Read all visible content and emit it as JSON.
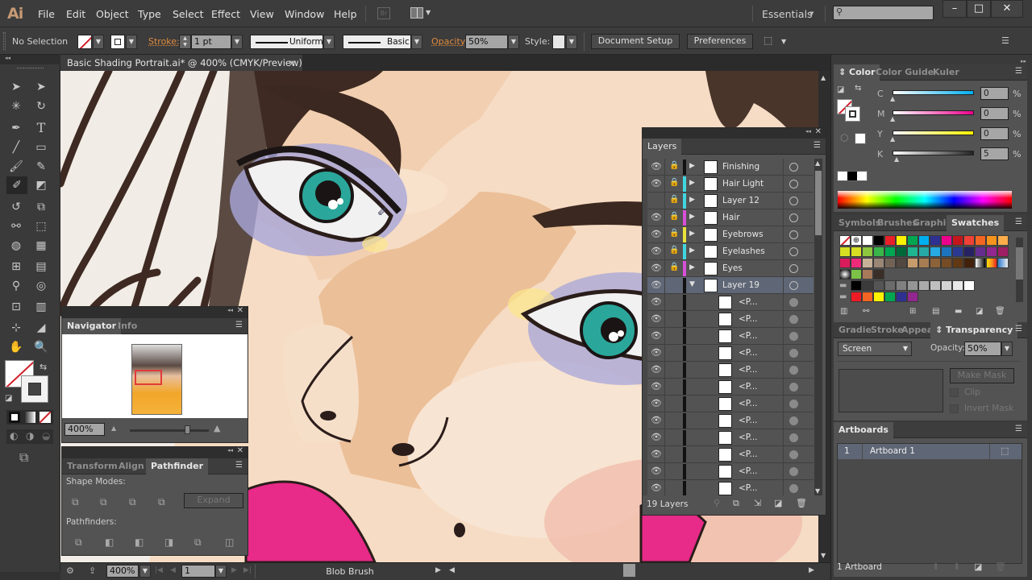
{
  "app": {
    "logo": "Ai",
    "menus": [
      "File",
      "Edit",
      "Object",
      "Type",
      "Select",
      "Effect",
      "View",
      "Window",
      "Help"
    ],
    "bridge_label": "Br",
    "workspace": "Essentials",
    "search_placeholder": "",
    "window_controls": {
      "minimize": "–",
      "maximize": "□",
      "close": "✕"
    }
  },
  "control_bar": {
    "selection_status": "No Selection",
    "stroke_label": "Stroke:",
    "stroke_weight": "1 pt",
    "profile": "Uniform",
    "brush": "Basic",
    "opacity_label": "Opacity:",
    "opacity": "50%",
    "style_label": "Style:",
    "document_setup": "Document Setup",
    "preferences": "Preferences"
  },
  "document": {
    "tab_title": "Basic Shading Portrait.ai* @ 400% (CMYK/Preview)",
    "close": "×"
  },
  "status_bar": {
    "zoom": "400%",
    "artboard_number": "1",
    "current_tool": "Blob Brush"
  },
  "navigator": {
    "tabs": [
      "Navigator",
      "Info"
    ],
    "active_tab": "Navigator",
    "zoom": "400%",
    "zoom_slider_fraction": 0.72
  },
  "pathfinder": {
    "tabs": [
      "Transform",
      "Align",
      "Pathfinder"
    ],
    "active_tab": "Pathfinder",
    "shape_modes_label": "Shape Modes:",
    "pathfinders_label": "Pathfinders:",
    "expand": "Expand",
    "shape_mode_icons": [
      "unite-icon",
      "minus-front-icon",
      "intersect-icon",
      "exclude-icon"
    ],
    "pathfinder_icons": [
      "divide-icon",
      "trim-icon",
      "merge-icon",
      "crop-icon",
      "outline-icon",
      "minus-back-icon"
    ]
  },
  "layers": {
    "title": "Layers",
    "count_label": "19 Layers",
    "rows": [
      {
        "name": "Finishing",
        "visible": true,
        "locked": true,
        "color": "#111111",
        "expanded": false,
        "sub": false
      },
      {
        "name": "Hair Light",
        "visible": true,
        "locked": true,
        "color": "#3fd6e0",
        "expanded": false,
        "sub": false
      },
      {
        "name": "Layer 12",
        "visible": false,
        "locked": true,
        "color": "#3fd6e0",
        "expanded": false,
        "sub": false
      },
      {
        "name": "Hair",
        "visible": true,
        "locked": true,
        "color": "#d84fd8",
        "expanded": false,
        "sub": false
      },
      {
        "name": "Eyebrows",
        "visible": true,
        "locked": true,
        "color": "#e8e23a",
        "expanded": false,
        "sub": false
      },
      {
        "name": "Eyelashes",
        "visible": true,
        "locked": true,
        "color": "#3fd6e0",
        "expanded": false,
        "sub": false
      },
      {
        "name": "Eyes",
        "visible": true,
        "locked": true,
        "color": "#d84fd8",
        "expanded": false,
        "sub": false
      },
      {
        "name": "Layer 19",
        "visible": true,
        "locked": false,
        "color": "#111111",
        "expanded": true,
        "sub": false,
        "selected": true
      },
      {
        "name": "<P...",
        "visible": true,
        "locked": false,
        "color": "#111111",
        "sub": true
      },
      {
        "name": "<P...",
        "visible": true,
        "locked": false,
        "color": "#111111",
        "sub": true
      },
      {
        "name": "<P...",
        "visible": true,
        "locked": false,
        "color": "#111111",
        "sub": true
      },
      {
        "name": "<P...",
        "visible": true,
        "locked": false,
        "color": "#111111",
        "sub": true
      },
      {
        "name": "<P...",
        "visible": true,
        "locked": false,
        "color": "#111111",
        "sub": true
      },
      {
        "name": "<P...",
        "visible": true,
        "locked": false,
        "color": "#111111",
        "sub": true
      },
      {
        "name": "<P...",
        "visible": true,
        "locked": false,
        "color": "#111111",
        "sub": true
      },
      {
        "name": "<P...",
        "visible": true,
        "locked": false,
        "color": "#111111",
        "sub": true
      },
      {
        "name": "<P...",
        "visible": true,
        "locked": false,
        "color": "#111111",
        "sub": true
      },
      {
        "name": "<P...",
        "visible": true,
        "locked": false,
        "color": "#111111",
        "sub": true
      },
      {
        "name": "<P...",
        "visible": true,
        "locked": false,
        "color": "#111111",
        "sub": true
      },
      {
        "name": "<P...",
        "visible": true,
        "locked": false,
        "color": "#111111",
        "sub": true
      }
    ]
  },
  "color_panel": {
    "tabs": [
      "Color",
      "Color Guide",
      "Kuler"
    ],
    "active_tab": "Color",
    "channels": [
      {
        "label": "C",
        "value": "0",
        "unit": "%"
      },
      {
        "label": "M",
        "value": "0",
        "unit": "%"
      },
      {
        "label": "Y",
        "value": "0",
        "unit": "%"
      },
      {
        "label": "K",
        "value": "5",
        "unit": "%"
      }
    ]
  },
  "swatches_panel": {
    "tabs": [
      "Symbols",
      "Brushes",
      "Graphic S",
      "Swatches"
    ],
    "active_tab": "Swatches",
    "row1": [
      "#ffffff",
      "#000000",
      "#e8202a",
      "#fff200",
      "#00a651",
      "#00aeef",
      "#2e3192",
      "#ec008c",
      "#c4161c",
      "#ef4136",
      "#f26522",
      "#f7941d",
      "#fbad4a"
    ],
    "row2": [
      "#d7df23",
      "#d7df23",
      "#8dc63f",
      "#39b54a",
      "#00a651",
      "#006838",
      "#1fb58f",
      "#26a9a6",
      "#27aae1",
      "#1c75bc",
      "#2b3990",
      "#262262",
      "#662d91",
      "#92278f",
      "#9e1f63"
    ],
    "row3": [
      "#da1c5c",
      "#ee2a7b",
      "#c7b299",
      "#998675",
      "#736357",
      "#534741",
      "#c69c6d",
      "#a67c52",
      "#8c6239",
      "#754c24",
      "#603813",
      "#42210b"
    ],
    "gray_row": [
      "#000000",
      "#3b3b3b",
      "#555555",
      "#6b6b6b",
      "#808080",
      "#959595",
      "#aaaaaa",
      "#bfbfbf",
      "#d4d4d4",
      "#e9e9e9",
      "#ffffff"
    ],
    "bright_row": [
      "#ed1c24",
      "#f26522",
      "#fff200",
      "#00a651",
      "#2e3192",
      "#92278f"
    ]
  },
  "transparency_panel": {
    "tabs": [
      "Gradie",
      "Stroke",
      "Appear",
      "Transparency"
    ],
    "active_tab": "Transparency",
    "blend_mode": "Screen",
    "opacity_label": "Opacity:",
    "opacity": "50%",
    "make_mask": "Make Mask",
    "clip": "Clip",
    "invert_mask": "Invert Mask"
  },
  "artboards_panel": {
    "title": "Artboards",
    "rows": [
      {
        "index": "1",
        "name": "Artboard 1"
      }
    ],
    "count_label": "1 Artboard"
  }
}
